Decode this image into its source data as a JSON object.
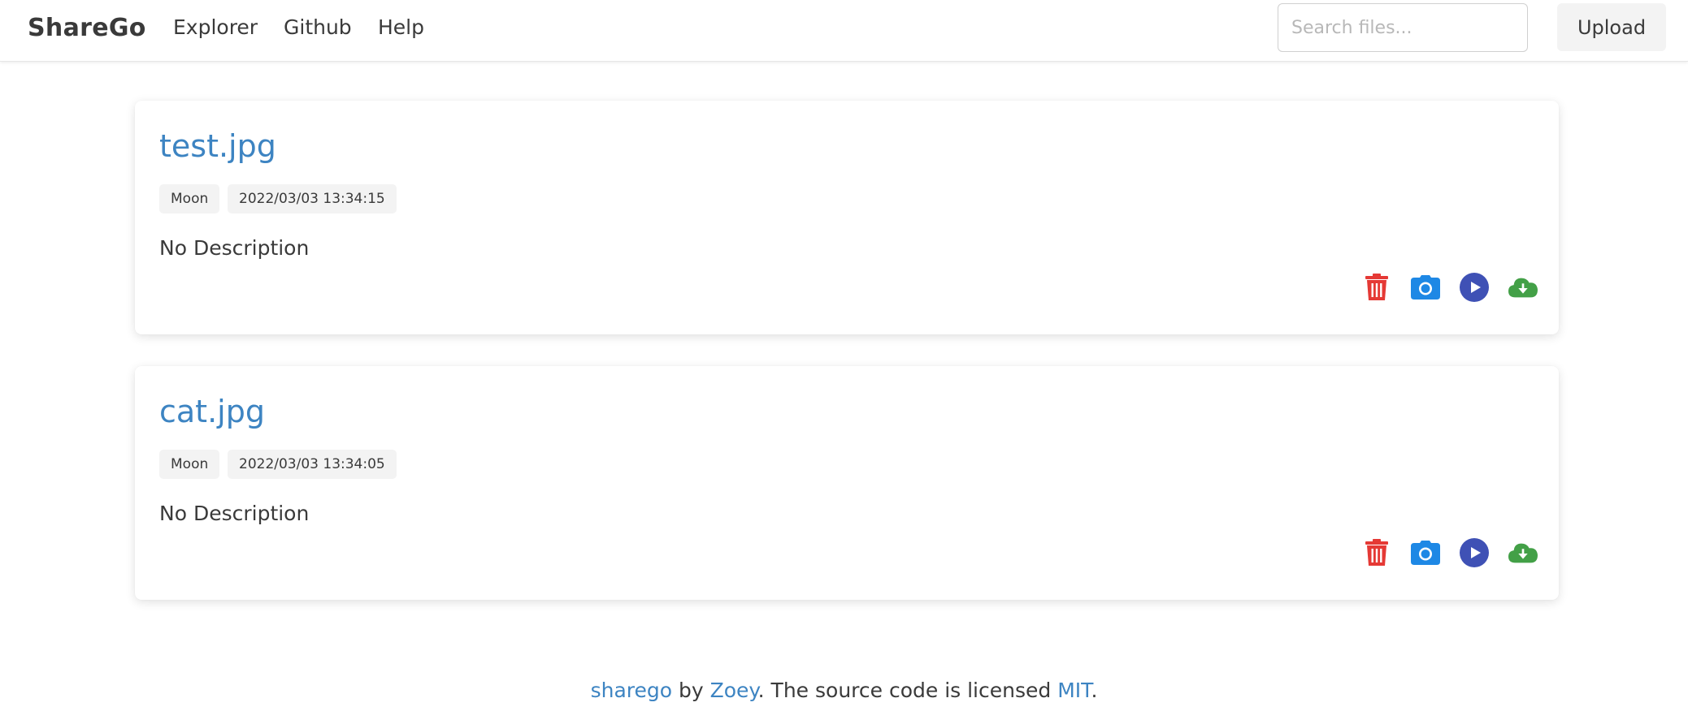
{
  "navbar": {
    "brand": "ShareGo",
    "links": [
      "Explorer",
      "Github",
      "Help"
    ],
    "search_placeholder": "Search files...",
    "upload_label": "Upload"
  },
  "files": [
    {
      "name": "test.jpg",
      "owner": "Moon",
      "timestamp": "2022/03/03 13:34:15",
      "description": "No Description",
      "actions": [
        "trash-icon",
        "camera-icon",
        "play-icon",
        "cloud-download-icon"
      ]
    },
    {
      "name": "cat.jpg",
      "owner": "Moon",
      "timestamp": "2022/03/03 13:34:05",
      "description": "No Description",
      "actions": [
        "trash-icon",
        "camera-icon",
        "play-icon",
        "cloud-download-icon"
      ]
    }
  ],
  "footer": {
    "project": "sharego",
    "by": " by ",
    "author": "Zoey",
    "text": ". The source code is licensed ",
    "license": "MIT",
    "end": "."
  },
  "colors": {
    "link": "#3d84c2",
    "trash": "#e53935",
    "camera": "#1e88e5",
    "play": "#3f51b5",
    "download": "#43a047"
  }
}
